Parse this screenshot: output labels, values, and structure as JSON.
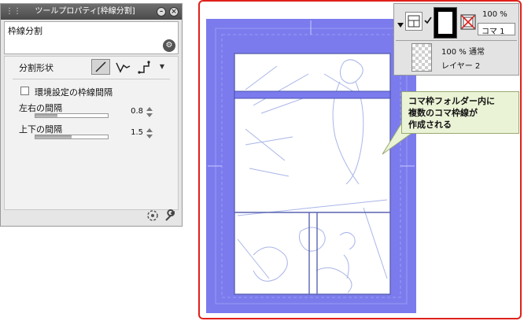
{
  "palette": {
    "title": "ツールプロパティ[枠線分割]",
    "tool_name": "枠線分割",
    "split_shape_label": "分割形状",
    "shape_options": [
      "straight-line-icon",
      "polyline-icon",
      "step-line-icon"
    ],
    "selected_shape": "straight-line-icon",
    "env_gap_checkbox_label": "環境設定の枠線間隔",
    "env_gap_checked": false,
    "horizontal_gap_label": "左右の間隔",
    "horizontal_gap_value": "0.8",
    "horizontal_gap_level": 0.3,
    "vertical_gap_label": "上下の間隔",
    "vertical_gap_value": "1.5",
    "vertical_gap_level": 0.5
  },
  "layers": {
    "folder_opacity": "100 %",
    "folder_name": "コマ 1",
    "layer_opacity_mode": "100 % 通常",
    "layer_name": "レイヤー 2"
  },
  "callout": {
    "line1": "コマ枠フォルダー内に",
    "line2": "複数のコマ枠線が",
    "line3": "作成される"
  },
  "colors": {
    "page_blue": "#7b7bee",
    "highlight_red": "#e0201a",
    "callout_bg": "#ebf3d6"
  }
}
